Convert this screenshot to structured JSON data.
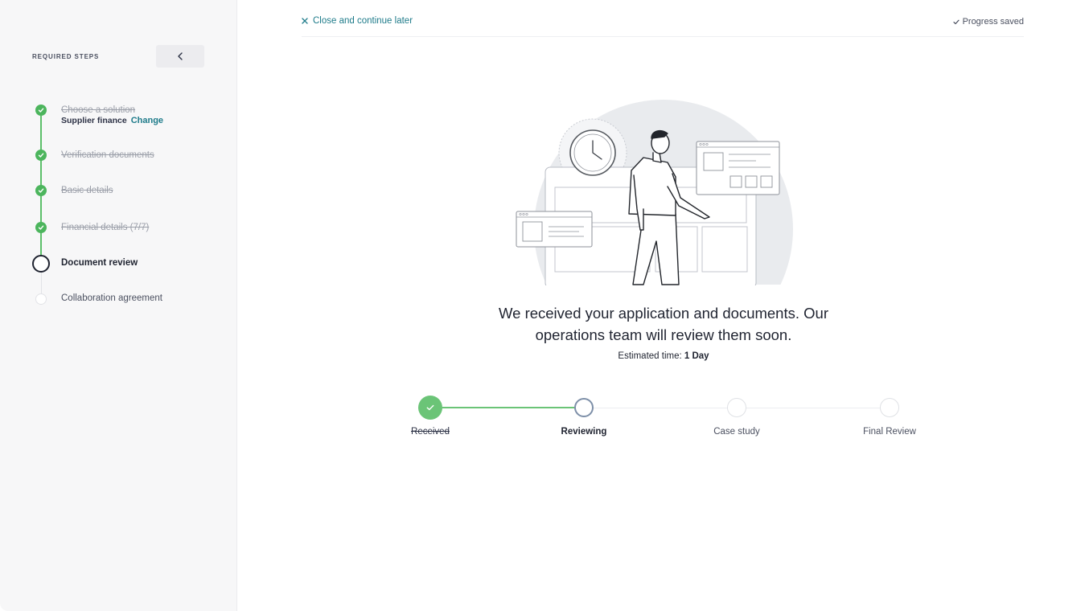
{
  "sidebar": {
    "section_label": "REQUIRED STEPS",
    "collapse_icon": "chevron-left-icon",
    "steps": [
      {
        "label": "Choose a solution",
        "status": "done"
      },
      {
        "label": "Verification documents",
        "status": "done"
      },
      {
        "label": "Basic details",
        "status": "done"
      },
      {
        "label": "Financial details (7/7)",
        "status": "done"
      },
      {
        "label": "Document review",
        "status": "current"
      },
      {
        "label": "Collaboration agreement",
        "status": "pending"
      }
    ],
    "selected_solution": "Supplier finance",
    "change_label": "Change"
  },
  "topbar": {
    "close_label": "Close and continue later",
    "saved_label": "Progress saved"
  },
  "main": {
    "headline_line1": "We received your application and documents. Our",
    "headline_line2": "operations team will review them soon.",
    "estimate_prefix": "Estimated time:",
    "estimate_value": "1 Day"
  },
  "tracker": {
    "stages": [
      {
        "label": "Received",
        "status": "done"
      },
      {
        "label": "Reviewing",
        "status": "current"
      },
      {
        "label": "Case study",
        "status": "pending"
      },
      {
        "label": "Final Review",
        "status": "pending"
      }
    ]
  },
  "colors": {
    "accent": "#1e7b8a",
    "success": "#4cb55d",
    "current_ring": "#7d8fa8"
  }
}
